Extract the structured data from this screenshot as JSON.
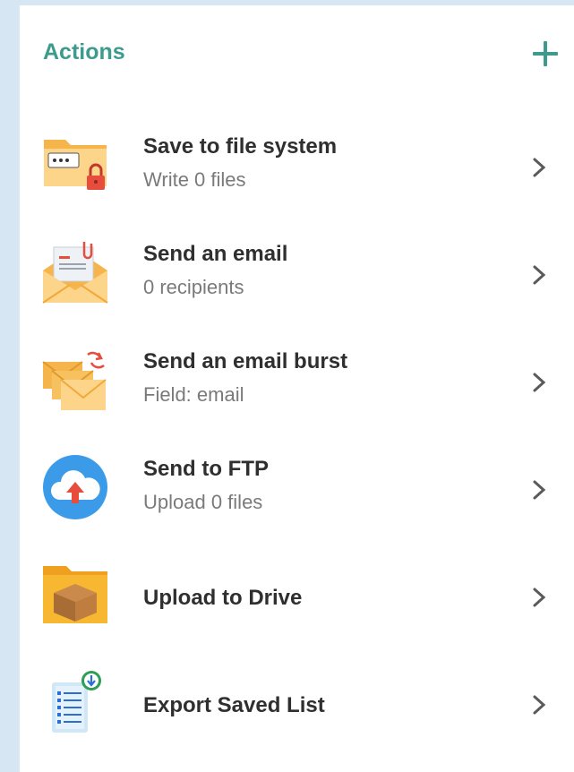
{
  "header": {
    "title": "Actions",
    "add_icon": "plus-icon"
  },
  "colors": {
    "accent": "#3d9b8d",
    "background": "#d7e6f3"
  },
  "actions": [
    {
      "label": "Save to file system",
      "sub": "Write 0 files",
      "icon": "folder-lock-icon"
    },
    {
      "label": "Send an email",
      "sub": "0 recipients",
      "icon": "email-icon"
    },
    {
      "label": "Send an email burst",
      "sub": "Field: email",
      "icon": "email-burst-icon"
    },
    {
      "label": "Send to FTP",
      "sub": "Upload 0 files",
      "icon": "cloud-upload-icon"
    },
    {
      "label": "Upload to Drive",
      "sub": "",
      "icon": "drive-folder-icon"
    },
    {
      "label": "Export Saved List",
      "sub": "",
      "icon": "export-list-icon"
    }
  ]
}
